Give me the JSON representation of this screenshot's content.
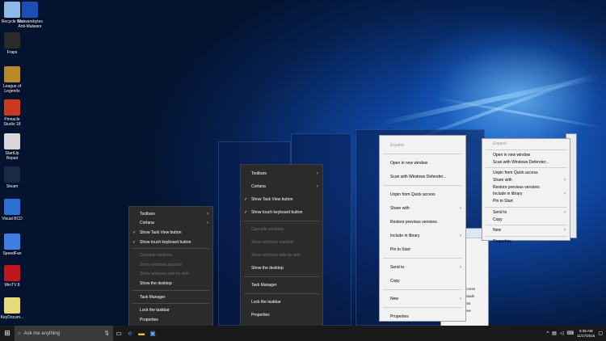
{
  "desktop_icons": [
    {
      "label": "Recycle Bin",
      "icon": "recycle-bin-icon",
      "color": "#8fb8e8"
    },
    {
      "label": "Malwarebytes Anti-Malware",
      "icon": "malwarebytes-icon",
      "color": "#1a4fb5"
    },
    {
      "label": "Fraps",
      "icon": "fraps-icon",
      "color": "#2a2a2a"
    },
    {
      "label": "League of Legends",
      "icon": "league-of-legends-icon",
      "color": "#b88a2a"
    },
    {
      "label": "Pinnacle Studio 18",
      "icon": "pinnacle-studio-icon",
      "color": "#c83a1e"
    },
    {
      "label": "StartUp Repair",
      "icon": "startup-repair-icon",
      "color": "#d8d8d8"
    },
    {
      "label": "Steam",
      "icon": "steam-icon",
      "color": "#1b2a44"
    },
    {
      "label": "Visual BCD",
      "icon": "visual-bcd-icon",
      "color": "#2f6fd1"
    },
    {
      "label": "SpeedFan",
      "icon": "speedfan-icon",
      "color": "#3d7ee0"
    },
    {
      "label": "WinTV 8",
      "icon": "wintv-icon",
      "color": "#c0171c"
    },
    {
      "label": "KeyDocum...",
      "icon": "document-icon",
      "color": "#e8d97a"
    }
  ],
  "menu1": {
    "items": [
      {
        "label": "Toolbars",
        "check": "",
        "disabled": false,
        "submenu": true
      },
      {
        "label": "Cortana",
        "check": "",
        "disabled": false,
        "submenu": true
      },
      {
        "label": "Show Task View button",
        "check": "✓",
        "disabled": false,
        "submenu": false
      },
      {
        "label": "Show touch keyboard button",
        "check": "✓",
        "disabled": false,
        "submenu": false
      },
      {
        "label": "Cascade windows",
        "check": "",
        "disabled": true,
        "submenu": false
      },
      {
        "label": "Show windows stacked",
        "check": "",
        "disabled": true,
        "submenu": false
      },
      {
        "label": "Show windows side by side",
        "check": "",
        "disabled": true,
        "submenu": false
      },
      {
        "label": "Show the desktop",
        "check": "",
        "disabled": false,
        "submenu": false
      },
      {
        "label": "Task Manager",
        "check": "",
        "disabled": false,
        "submenu": false
      },
      {
        "label": "Lock the taskbar",
        "check": "",
        "disabled": false,
        "submenu": false
      },
      {
        "label": "Properties",
        "check": "",
        "disabled": false,
        "submenu": false
      }
    ]
  },
  "menu2": {
    "items": [
      {
        "label": "Toolbars",
        "check": "",
        "disabled": false,
        "submenu": true
      },
      {
        "label": "Cortana",
        "check": "",
        "disabled": false,
        "submenu": true
      },
      {
        "label": "Show Task View button",
        "check": "✓",
        "disabled": false,
        "submenu": false
      },
      {
        "label": "Show touch keyboard button",
        "check": "✓",
        "disabled": false,
        "submenu": false
      },
      {
        "label": "Cascade windows",
        "check": "",
        "disabled": true,
        "submenu": false
      },
      {
        "label": "Show windows stacked",
        "check": "",
        "disabled": true,
        "submenu": false
      },
      {
        "label": "Show windows side by side",
        "check": "",
        "disabled": true,
        "submenu": false
      },
      {
        "label": "Show the desktop",
        "check": "",
        "disabled": false,
        "submenu": false
      },
      {
        "label": "Task Manager",
        "check": "",
        "disabled": false,
        "submenu": false
      },
      {
        "label": "Lock the taskbar",
        "check": "",
        "disabled": false,
        "submenu": false
      },
      {
        "label": "Properties",
        "check": "",
        "disabled": false,
        "submenu": false
      }
    ]
  },
  "menu3": {
    "items": [
      {
        "label": "Expand",
        "disabled": true,
        "submenu": false
      },
      {
        "label": "Open in new window",
        "disabled": false,
        "submenu": false
      },
      {
        "label": "Scan with Windows Defender...",
        "disabled": false,
        "submenu": false
      },
      {
        "label": "Unpin from Quick access",
        "disabled": false,
        "submenu": false
      },
      {
        "label": "Share with",
        "disabled": false,
        "submenu": true
      },
      {
        "label": "Restore previous versions",
        "disabled": false,
        "submenu": false
      },
      {
        "label": "Include in library",
        "disabled": false,
        "submenu": true
      },
      {
        "label": "Pin to Start",
        "disabled": false,
        "submenu": false
      },
      {
        "label": "Send to",
        "disabled": false,
        "submenu": true
      },
      {
        "label": "Copy",
        "disabled": false,
        "submenu": false
      },
      {
        "label": "New",
        "disabled": false,
        "submenu": true
      },
      {
        "label": "Properties",
        "disabled": false,
        "submenu": false
      }
    ]
  },
  "menu4": {
    "items": [
      {
        "label": "Expand",
        "disabled": true,
        "submenu": false
      },
      {
        "label": "Open in new window",
        "disabled": false,
        "submenu": false
      },
      {
        "label": "Scan with Windows Defender...",
        "disabled": false,
        "submenu": false
      },
      {
        "label": "Unpin from Quick access",
        "disabled": false,
        "submenu": false
      },
      {
        "label": "Share with",
        "disabled": false,
        "submenu": true
      },
      {
        "label": "Restore previous versions",
        "disabled": false,
        "submenu": false
      },
      {
        "label": "Include in library",
        "disabled": false,
        "submenu": true
      },
      {
        "label": "Pin to Start",
        "disabled": false,
        "submenu": false
      },
      {
        "label": "Send to",
        "disabled": false,
        "submenu": true
      },
      {
        "label": "Copy",
        "disabled": false,
        "submenu": false
      },
      {
        "label": "New",
        "disabled": false,
        "submenu": true
      },
      {
        "label": "Properties",
        "disabled": false,
        "submenu": false
      }
    ]
  },
  "explorer_fragments": {
    "nav_items": [
      "access",
      "nloads",
      "ents",
      "ures",
      "ic"
    ],
    "tab_text": "Reca"
  },
  "taskbar": {
    "search_placeholder": "Ask me anything",
    "time": "6:35 AM",
    "date": "11/17/2015"
  },
  "colors": {
    "taskbar_bg": "#1a1a1a",
    "menu_dark_bg": "#2b2b2b",
    "menu_light_bg": "#f2f2f2"
  }
}
